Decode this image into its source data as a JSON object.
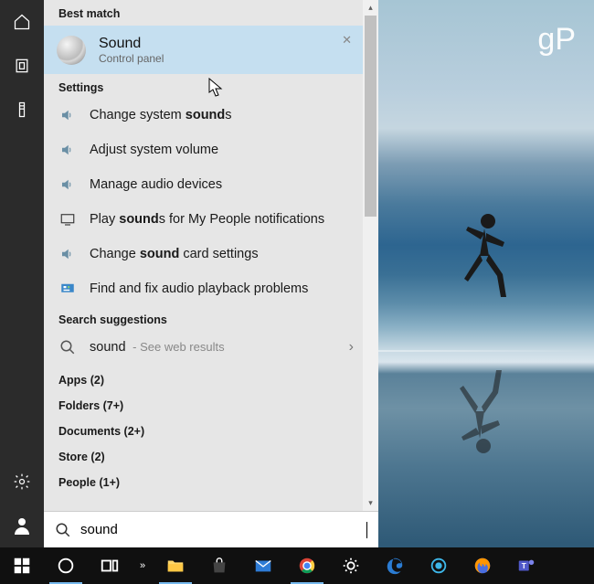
{
  "watermark": "gP",
  "sections": {
    "best_match": "Best match",
    "settings": "Settings",
    "suggestions": "Search suggestions"
  },
  "best": {
    "title": "Sound",
    "subtitle": "Control panel"
  },
  "settings_items": [
    {
      "pre": "Change system ",
      "bold": "sound",
      "post": "s"
    },
    {
      "pre": "Adjust system volume",
      "bold": "",
      "post": ""
    },
    {
      "pre": "Manage audio devices",
      "bold": "",
      "post": ""
    },
    {
      "pre": "Play ",
      "bold": "sound",
      "post": "s for My People notifications"
    },
    {
      "pre": "Change ",
      "bold": "sound",
      "post": " card settings"
    },
    {
      "pre": "Find and fix audio playback problems",
      "bold": "",
      "post": ""
    }
  ],
  "settings_icons": [
    "speaker",
    "speaker",
    "speaker",
    "monitor",
    "speaker",
    "troubleshoot"
  ],
  "suggestion": {
    "term": "sound",
    "hint": "See web results"
  },
  "categories": [
    "Apps (2)",
    "Folders (7+)",
    "Documents (2+)",
    "Store (2)",
    "People (1+)"
  ],
  "search_value": "sound",
  "rail_icons": [
    "home",
    "frame",
    "tower",
    "gear",
    "user"
  ]
}
